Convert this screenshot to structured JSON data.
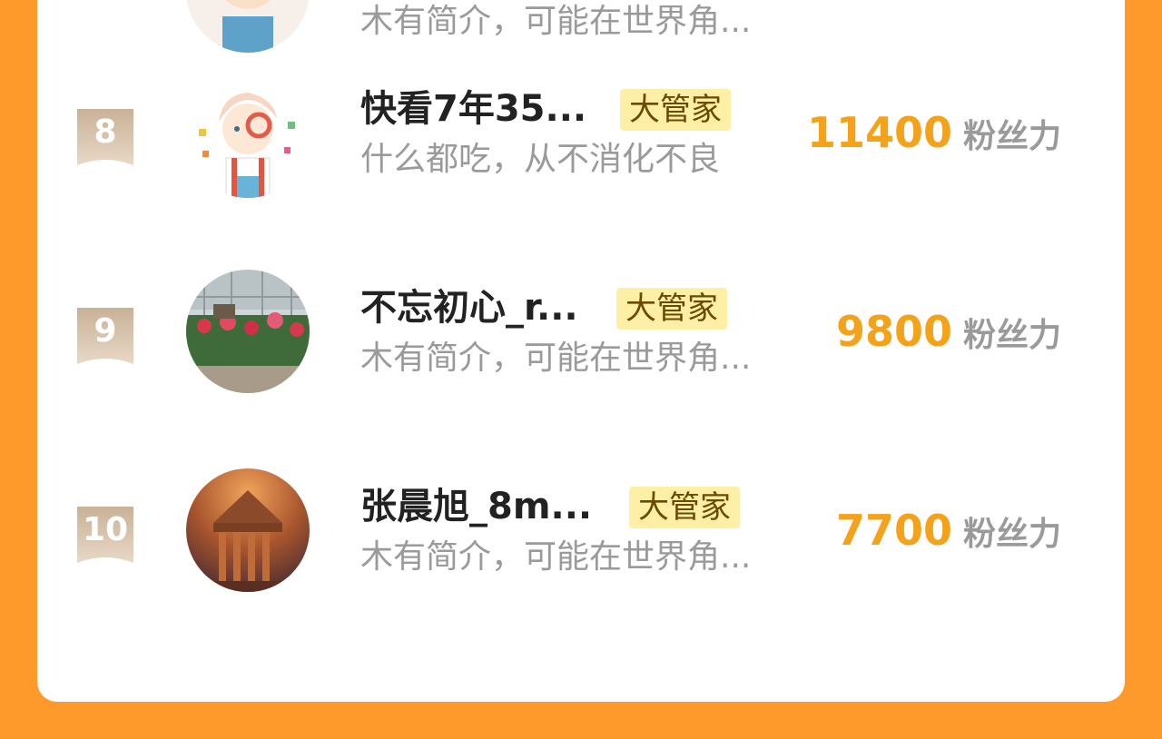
{
  "rows": [
    {
      "rank": "",
      "name": "",
      "badge": "",
      "desc": "木有简介，可能在世界角...",
      "score": "",
      "unit": "",
      "avatar": "anime-character-avatar"
    },
    {
      "rank": "8",
      "name": "快看7年35...",
      "badge": "大管家",
      "desc": "什么都吃，从不消化不良",
      "score": "11400",
      "unit": "粉丝力",
      "avatar": "anime-character-avatar"
    },
    {
      "rank": "9",
      "name": "不忘初心_r...",
      "badge": "大管家",
      "desc": "木有简介，可能在世界角...",
      "score": "9800",
      "unit": "粉丝力",
      "avatar": "garden-greenhouse-photo"
    },
    {
      "rank": "10",
      "name": "张晨旭_8m...",
      "badge": "大管家",
      "desc": "木有简介，可能在世界角...",
      "score": "7700",
      "unit": "粉丝力",
      "avatar": "ancient-temple-photo"
    }
  ],
  "colors": {
    "background": "#fd9a2b",
    "score": "#f4a21a",
    "badge_bg": "#fdf0a6",
    "rank_ribbon": "#d9c2a8"
  }
}
